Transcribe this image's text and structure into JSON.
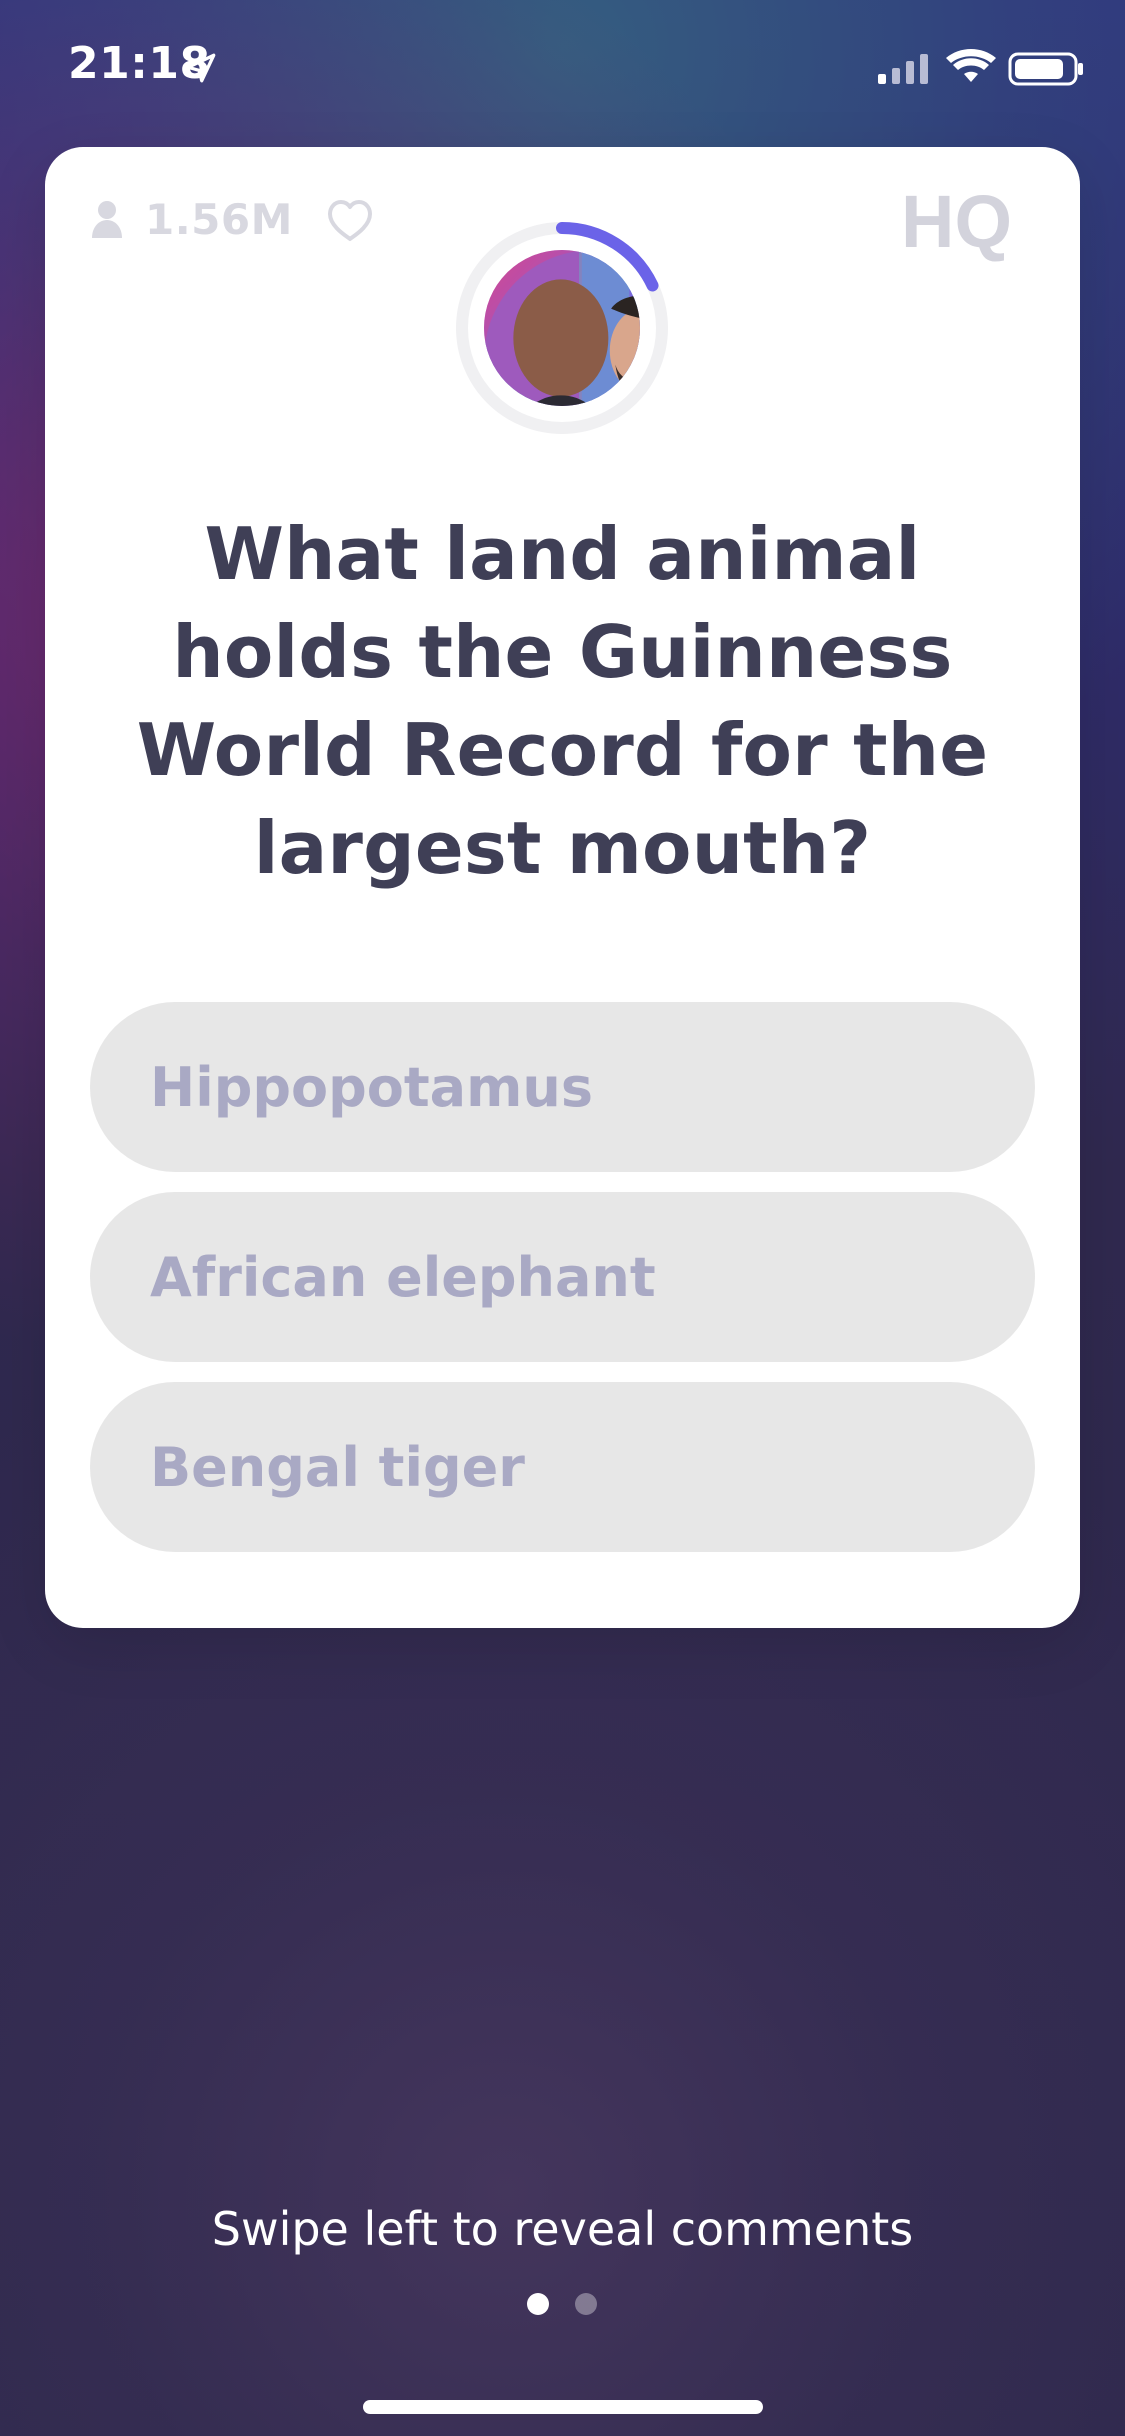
{
  "status_bar": {
    "time": "21:18",
    "location_icon": "location-arrow-icon",
    "signal_icon": "cellular-signal-icon",
    "wifi_icon": "wifi-icon",
    "battery_icon": "battery-icon"
  },
  "card": {
    "viewer_count": "1.56M",
    "viewer_icon": "person-icon",
    "like_icon": "heart-icon",
    "brand_logo": "HQ",
    "host_avatar_icon": "host-avatar-icon",
    "timer_progress": 0.18,
    "question": "What land animal holds the Guinness World Record for the largest mouth?",
    "answers": [
      "Hippopotamus",
      "African elephant",
      "Bengal tiger"
    ]
  },
  "footer": {
    "swipe_hint": "Swipe left to reveal comments",
    "page_index": 1,
    "page_count": 2
  },
  "colors": {
    "card_background": "#ffffff",
    "question_text": "#3f3f56",
    "answer_background": "#e7e7e7",
    "answer_text": "#a9a9c4",
    "accent_ring": "#6b63e8",
    "logo_gray": "#d3d3dc"
  }
}
